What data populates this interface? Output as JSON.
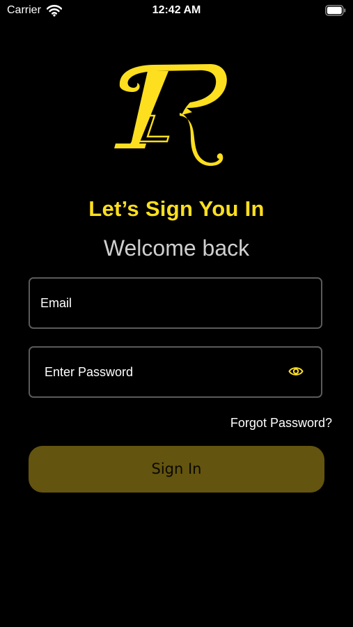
{
  "status_bar": {
    "carrier": "Carrier",
    "time": "12:42 AM",
    "icons": [
      "wifi-icon",
      "battery-icon"
    ]
  },
  "logo": {
    "icon": "brand-monogram-logo",
    "color": "#fddf1f"
  },
  "heading": {
    "title": "Let’s Sign You In",
    "subtitle": "Welcome back"
  },
  "form": {
    "email_placeholder": "Email",
    "password_placeholder": "Enter Password",
    "password_toggle_icon": "eye-icon",
    "forgot_password": "Forgot Password?",
    "submit_label": "Sign In"
  },
  "colors": {
    "background": "#000000",
    "accent": "#fddf1f",
    "button": "#63540f",
    "field_border": "#5b5b5b",
    "subtitle": "#cfcfcf"
  }
}
